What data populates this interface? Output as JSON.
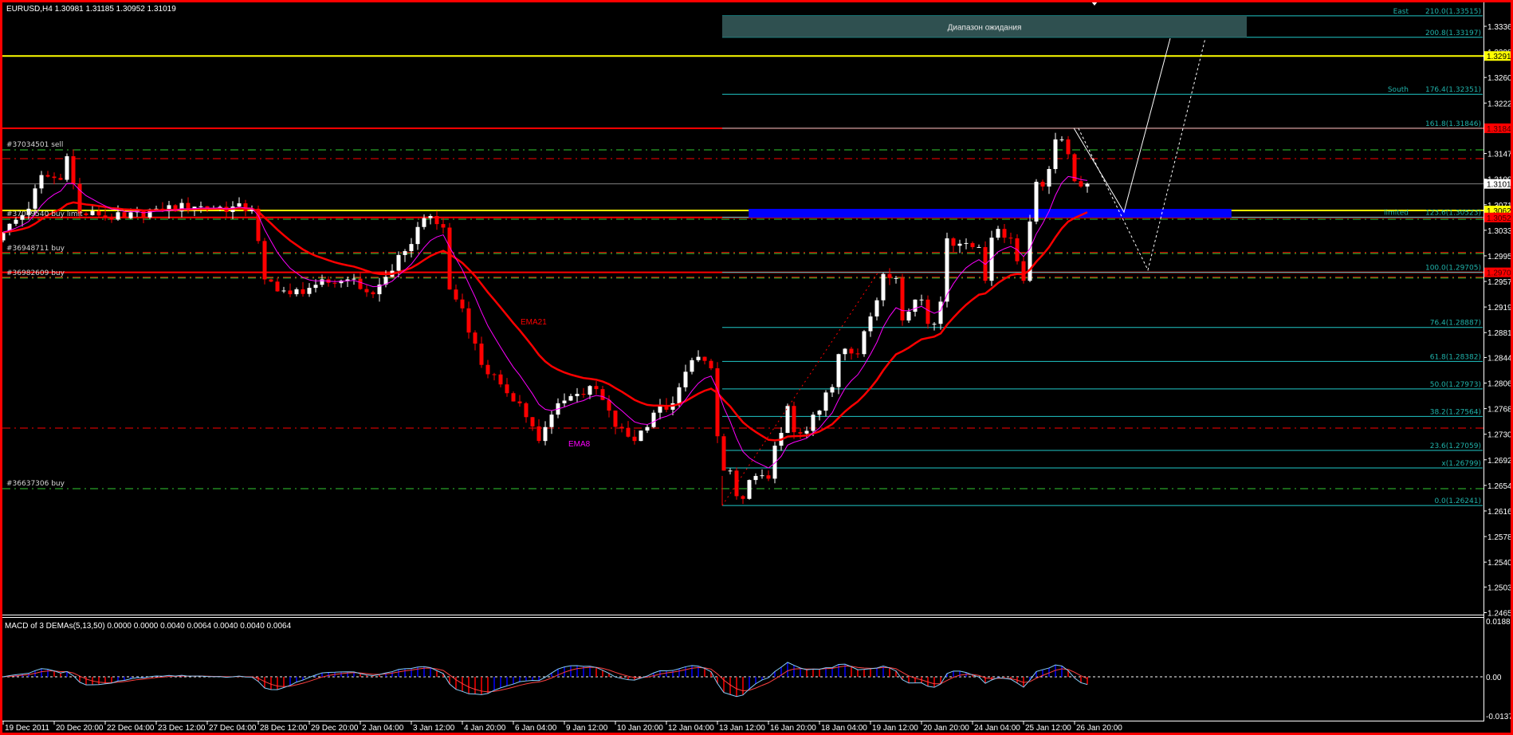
{
  "header": {
    "symbol_info": "EURUSD,H4  1.30981 1.31185 1.30952 1.31019"
  },
  "colors": {
    "background": "#000000",
    "frame": "#ff0000",
    "bull": "#ffffff",
    "bear": "#ff0000",
    "ema8": "#ff00ff",
    "ema21": "#ff0000",
    "fib": "#20c8c8",
    "fib_text": "#20b2aa",
    "macd_line": "#87cefa",
    "macd_signal": "#ff4040",
    "hist_up": "#0000ff",
    "hist_down": "#ff0000",
    "box_fill": "#2f5050",
    "zone_fill": "#0000ff"
  },
  "indicators": {
    "ema8_label": "EMA8",
    "ema21_label": "EMA21",
    "ema8_period": 8,
    "ema21_period": 21
  },
  "expectation_box": {
    "label": "Диапазон ожидания",
    "bar_from": 112.75,
    "bar_to": 195,
    "price_top": 1.33515,
    "price_bottom": 1.33197
  },
  "blue_zone": {
    "bar_from": 116.9,
    "bar_to": 192.6,
    "price_top": 1.30648,
    "price_bottom": 1.30518
  },
  "fibonacci": {
    "bar_from": 112.75,
    "levels": [
      {
        "tag": "East",
        "label": "210.0(1.33515)",
        "price": 1.33515
      },
      {
        "tag": "",
        "label": "200.8(1.33197)",
        "price": 1.33197
      },
      {
        "tag": "South",
        "label": "176.4(1.32351)",
        "price": 1.32351
      },
      {
        "tag": "",
        "label": "161.8(1.31846)",
        "price": 1.31846
      },
      {
        "tag": "limited",
        "label": "123.6(1.30523)",
        "price": 1.30523
      },
      {
        "tag": "",
        "label": "100.0(1.29705)",
        "price": 1.29705
      },
      {
        "tag": "",
        "label": "76.4(1.28887)",
        "price": 1.28887
      },
      {
        "tag": "",
        "label": "61.8(1.28382)",
        "price": 1.28382
      },
      {
        "tag": "",
        "label": "50.0(1.27973)",
        "price": 1.27973
      },
      {
        "tag": "",
        "label": "38.2(1.27564)",
        "price": 1.27564
      },
      {
        "tag": "",
        "label": "23.6(1.27059)",
        "price": 1.27059
      },
      {
        "tag": "",
        "label": "x(1.26799)",
        "price": 1.26799
      },
      {
        "tag": "",
        "label": "0.0(1.26241)",
        "price": 1.26241
      }
    ]
  },
  "horizontal_lines": [
    {
      "price": 1.32919,
      "color": "#ffff00",
      "style": "solid",
      "width": 2
    },
    {
      "price": 1.31846,
      "color": "#ff0000",
      "style": "solid",
      "width": 2
    },
    {
      "price": 1.31524,
      "color": "#32cd32",
      "style": "dashdot",
      "width": 1
    },
    {
      "price": 1.31394,
      "color": "#ff0000",
      "style": "dashdot",
      "width": 1
    },
    {
      "price": 1.31019,
      "color": "#808080",
      "style": "solid",
      "width": 1
    },
    {
      "price": 1.30624,
      "color": "#ffff00",
      "style": "solid",
      "width": 2
    },
    {
      "price": 1.3052,
      "color": "#ff0000",
      "style": "solid",
      "width": 2
    },
    {
      "price": 1.30494,
      "color": "#32cd32",
      "style": "dashdot",
      "width": 1
    },
    {
      "price": 1.29999,
      "color": "#ff0000",
      "style": "dashdot",
      "width": 1
    },
    {
      "price": 1.29985,
      "color": "#32cd32",
      "style": "dashdot",
      "width": 1
    },
    {
      "price": 1.29705,
      "color": "#ff0000",
      "style": "solid",
      "width": 2
    },
    {
      "price": 1.29632,
      "color": "#ff0000",
      "style": "dashdot",
      "width": 1
    },
    {
      "price": 1.2962,
      "color": "#32cd32",
      "style": "dashdot",
      "width": 1
    },
    {
      "price": 1.27391,
      "color": "#ff0000",
      "style": "dashdot",
      "width": 1
    },
    {
      "price": 1.26491,
      "color": "#32cd32",
      "style": "dashdot",
      "width": 1
    }
  ],
  "orders": [
    {
      "label": "#37034501 sell",
      "price": 1.31524
    },
    {
      "label": "#37049540 buy limit",
      "price": 1.30494
    },
    {
      "label": "#36948711 buy",
      "price": 1.29985
    },
    {
      "label": "#36982609 buy",
      "price": 1.2962
    },
    {
      "label": "#36637306 buy",
      "price": 1.26491
    }
  ],
  "price_axis": {
    "ticks": [
      "1.33360",
      "1.32980",
      "1.32600",
      "1.32220",
      "1.31840",
      "1.31470",
      "1.31090",
      "1.30710",
      "1.30330",
      "1.29950",
      "1.29570",
      "1.29190",
      "1.28810",
      "1.28440",
      "1.28060",
      "1.27680",
      "1.27300",
      "1.26920",
      "1.26540",
      "1.26160",
      "1.25780",
      "1.25400",
      "1.25030",
      "1.24650"
    ],
    "tags": [
      {
        "label": "1.32919",
        "price": 1.32919,
        "bg": "#ffff00",
        "fg": "#000000"
      },
      {
        "label": "1.31846",
        "price": 1.31846,
        "bg": "#ff0000",
        "fg": "#400000"
      },
      {
        "label": "1.31019",
        "price": 1.31019,
        "bg": "#ffffff",
        "fg": "#000000"
      },
      {
        "label": "1.30624",
        "price": 1.30624,
        "bg": "#ffff00",
        "fg": "#000000"
      },
      {
        "label": "1.30520",
        "price": 1.3052,
        "bg": "#ff0000",
        "fg": "#400000"
      },
      {
        "label": "1.29705",
        "price": 1.29705,
        "bg": "#ff0000",
        "fg": "#400000"
      }
    ]
  },
  "time_axis": {
    "bars_per_label": 8,
    "labels": [
      "19 Dec 2011",
      "20 Dec 20:00",
      "22 Dec 04:00",
      "23 Dec 12:00",
      "27 Dec 04:00",
      "28 Dec 12:00",
      "29 Dec 20:00",
      "2 Jan 04:00",
      "3 Jan 12:00",
      "4 Jan 20:00",
      "6 Jan 04:00",
      "9 Jan 12:00",
      "10 Jan 20:00",
      "12 Jan 04:00",
      "13 Jan 12:00",
      "16 Jan 20:00",
      "18 Jan 04:00",
      "19 Jan 12:00",
      "20 Jan 20:00",
      "24 Jan 04:00",
      "25 Jan 12:00",
      "26 Jan 20:00"
    ]
  },
  "projections": {
    "solid": [
      [
        167.9,
        1.31846
      ],
      [
        175.75,
        1.306
      ],
      [
        183,
        1.33183
      ]
    ],
    "dashed": [
      [
        168.6,
        1.31846
      ],
      [
        179.5,
        1.2974
      ],
      [
        188.5,
        1.33183
      ]
    ],
    "fib_diagonal": [
      [
        112.75,
        1.26241
      ],
      [
        137.2,
        1.29705
      ]
    ]
  },
  "macd": {
    "label": "MACD of 3 DEMAs(5,13,50) 0.0000 0.0000 0.0040 0.0064 0.0040 0.0040 0.0064",
    "scale_top": "0.0188",
    "scale_zero": "0.00",
    "scale_bottom": "-0.0137"
  },
  "chart_data": {
    "type": "candlestick",
    "symbol": "EURUSD",
    "timeframe": "H4",
    "bar_count": 171,
    "ylim": [
      1.2465,
      1.3355
    ],
    "close_anchors": [
      [
        0,
        1.303
      ],
      [
        4,
        1.3065
      ],
      [
        6,
        1.3115
      ],
      [
        9,
        1.3108
      ],
      [
        10,
        1.3143
      ],
      [
        12,
        1.3058
      ],
      [
        15,
        1.3055
      ],
      [
        19,
        1.3051
      ],
      [
        24,
        1.3065
      ],
      [
        30,
        1.3068
      ],
      [
        39,
        1.3065
      ],
      [
        41,
        1.296
      ],
      [
        45,
        1.2938
      ],
      [
        49,
        1.2952
      ],
      [
        54,
        1.296
      ],
      [
        58,
        1.2938
      ],
      [
        63,
        1.3002
      ],
      [
        66,
        1.3051
      ],
      [
        69,
        1.3037
      ],
      [
        70,
        1.2945
      ],
      [
        72,
        1.2917
      ],
      [
        75,
        1.2833
      ],
      [
        78,
        1.2804
      ],
      [
        81,
        1.2776
      ],
      [
        84,
        1.272
      ],
      [
        87,
        1.2776
      ],
      [
        90,
        1.279
      ],
      [
        93,
        1.2797
      ],
      [
        96,
        1.2741
      ],
      [
        99,
        1.272
      ],
      [
        102,
        1.2762
      ],
      [
        105,
        1.2776
      ],
      [
        108,
        1.284
      ],
      [
        109,
        1.2845
      ],
      [
        110,
        1.2839
      ],
      [
        111,
        1.2828
      ],
      [
        112,
        1.2727
      ],
      [
        113,
        1.2676
      ],
      [
        114,
        1.2676
      ],
      [
        115,
        1.2638
      ],
      [
        116,
        1.2634
      ],
      [
        117,
        1.2662
      ],
      [
        118,
        1.2668
      ],
      [
        119,
        1.2669
      ],
      [
        120,
        1.2664
      ],
      [
        121,
        1.2713
      ],
      [
        122,
        1.2732
      ],
      [
        123,
        1.2772
      ],
      [
        124,
        1.2733
      ],
      [
        125,
        1.2731
      ],
      [
        126,
        1.2735
      ],
      [
        127,
        1.2759
      ],
      [
        128,
        1.2765
      ],
      [
        129,
        1.2792
      ],
      [
        130,
        1.28
      ],
      [
        131,
        1.2849
      ],
      [
        132,
        1.2857
      ],
      [
        133,
        1.285
      ],
      [
        134,
        1.2849
      ],
      [
        135,
        1.2883
      ],
      [
        136,
        1.2905
      ],
      [
        137,
        1.2929
      ],
      [
        138,
        1.2968
      ],
      [
        139,
        1.2962
      ],
      [
        140,
        1.2962
      ],
      [
        141,
        1.2899
      ],
      [
        142,
        1.2912
      ],
      [
        143,
        1.293
      ],
      [
        144,
        1.293
      ],
      [
        145,
        1.2894
      ],
      [
        146,
        1.2894
      ],
      [
        147,
        1.2927
      ],
      [
        148,
        1.3021
      ],
      [
        149,
        1.301
      ],
      [
        150,
        1.3013
      ],
      [
        151,
        1.3014
      ],
      [
        152,
        1.3008
      ],
      [
        153,
        1.3008
      ],
      [
        154,
        1.2958
      ],
      [
        155,
        1.3022
      ],
      [
        156,
        1.3035
      ],
      [
        157,
        1.3022
      ],
      [
        158,
        1.3021
      ],
      [
        159,
        1.2987
      ],
      [
        160,
        1.2958
      ],
      [
        161,
        1.3046
      ],
      [
        162,
        1.3105
      ],
      [
        163,
        1.3098
      ],
      [
        164,
        1.3124
      ],
      [
        165,
        1.3168
      ],
      [
        166,
        1.3168
      ],
      [
        167,
        1.3146
      ],
      [
        168,
        1.3106
      ],
      [
        169,
        1.3098
      ],
      [
        170,
        1.31019
      ]
    ]
  }
}
